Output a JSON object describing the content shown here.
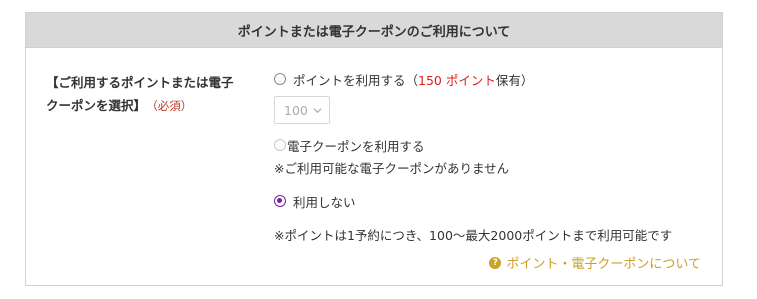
{
  "header": {
    "title": "ポイントまたは電子クーポンのご利用について"
  },
  "field": {
    "label_line1": "【ご利用するポイントまたは電子",
    "label_line2": "クーポンを選択】",
    "required": "（必須）"
  },
  "options": {
    "points": {
      "prefix": "ポイントを利用する（",
      "amount": "150 ポイント",
      "suffix": "保有）",
      "selected": false
    },
    "points_select": {
      "value": "100",
      "disabled": true
    },
    "coupon": {
      "label": "電子クーポンを利用する",
      "disabled": true,
      "note": "※ご利用可能な電子クーポンがありません"
    },
    "none": {
      "label": "利用しない",
      "selected": true
    }
  },
  "footer_note": "※ポイントは1予約につき、100〜最大2000ポイントまで利用可能です",
  "help_link": {
    "icon": "question-circle-icon",
    "label": "ポイント・電子クーポンについて"
  },
  "colors": {
    "accent": "#7a1ea1",
    "points_red": "#e01e1e",
    "link_gold": "#c9a227",
    "header_bg": "#d9d9d9"
  }
}
